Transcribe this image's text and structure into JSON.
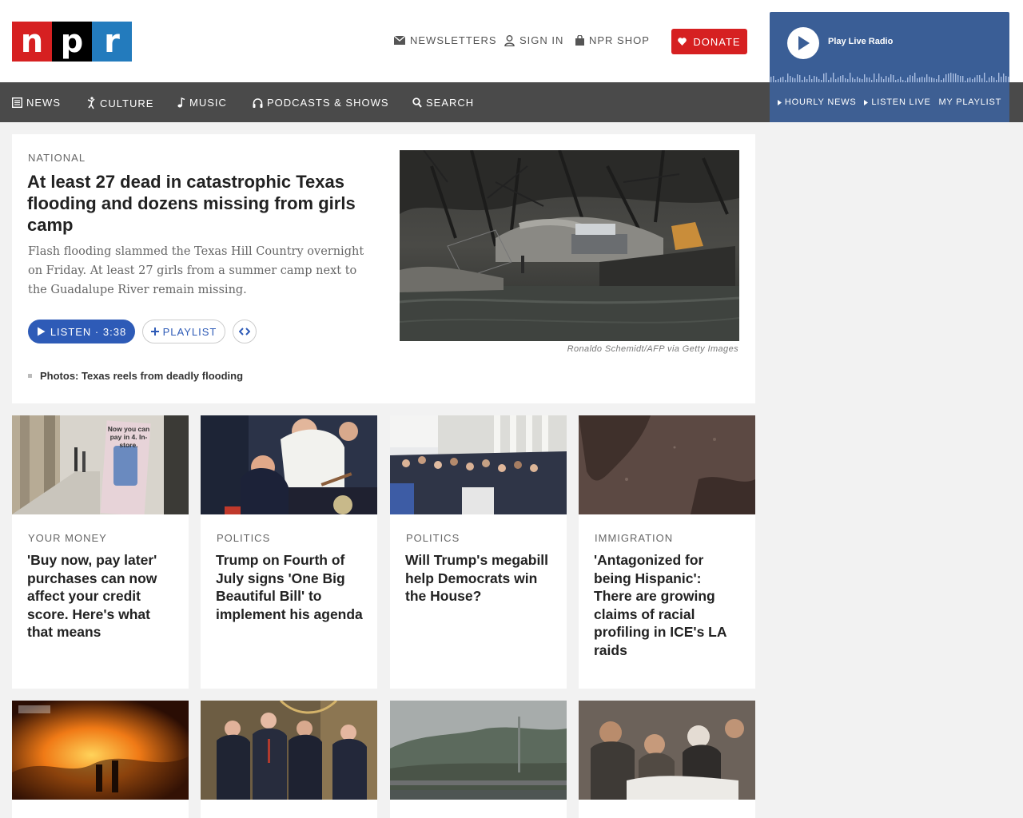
{
  "brand": {
    "letters": [
      "n",
      "p",
      "r"
    ],
    "colors": {
      "n": "#d62021",
      "p": "#000000",
      "r": "#237bbd"
    }
  },
  "header": {
    "newsletters": "Newsletters",
    "sign_in": "Sign In",
    "shop": "NPR Shop",
    "donate": "Donate"
  },
  "player": {
    "play_label": "Play Live Radio",
    "links": [
      "Hourly News",
      "Listen Live",
      "My Playlist"
    ]
  },
  "nav": {
    "items": [
      "News",
      "Culture",
      "Music",
      "Podcasts & Shows",
      "Search"
    ]
  },
  "lead": {
    "slug": "National",
    "headline": "At least 27 dead in catastrophic Texas flooding and dozens missing from girls camp",
    "teaser": "Flash flooding slammed the Texas Hill Country overnight on Friday. At least 27 girls from a summer camp next to the Guadalupe River remain missing.",
    "listen_label": "Listen · 3:38",
    "playlist_label": "Playlist",
    "related": "Photos: Texas reels from deadly flooding",
    "credit": "Ronaldo Schemidt/AFP via Getty Images"
  },
  "cards": [
    {
      "slug": "Your Money",
      "title": "'Buy now, pay later' purchases can now affect your credit score. Here's what that means",
      "sign_text": "Now you can pay in 4. In-store."
    },
    {
      "slug": "Politics",
      "title": "Trump on Fourth of July signs 'One Big Beautiful Bill' to implement his agenda"
    },
    {
      "slug": "Politics",
      "title": "Will Trump's megabill help Democrats win the House?"
    },
    {
      "slug": "Immigration",
      "title": "'Antagonized for being Hispanic': There are growing claims of racial profiling in ICE's LA raids"
    }
  ],
  "colors": {
    "accent_red": "#d62021",
    "listen_blue": "#2e5bb7",
    "player_blue": "#3a5e96",
    "nav_gray": "#4a4a4a"
  }
}
